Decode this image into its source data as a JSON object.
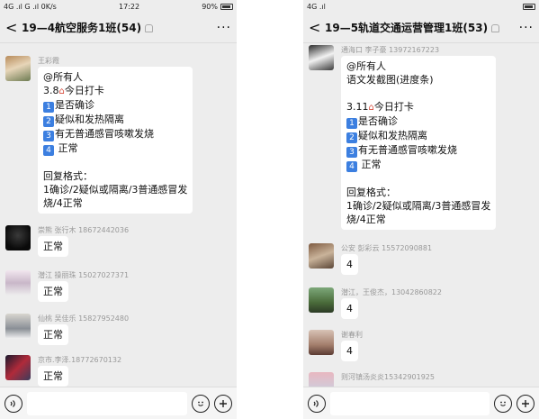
{
  "left": {
    "status": {
      "signal": "4G .ıl G .ıl 0K/s",
      "time": "17:22",
      "battery": "90%"
    },
    "nav": {
      "back": "<",
      "title": "19—4航空服务1班(54)",
      "more": "···"
    },
    "timestamp": "",
    "messages": [
      {
        "sender": "王彩霞",
        "lines": [
          "@所有人",
          "3.8{house}今日打卡",
          "{1}是否确诊",
          "{2}疑似和发热隔离",
          "{3}有无普通感冒咳嗽发烧",
          "{4} 正常",
          "",
          "回复格式：",
          "1确诊/2疑似或隔离/3普通感冒发",
          "烧/4正常"
        ]
      },
      {
        "sender": "崇熊      张行木 18672442036",
        "lines": [
          "正常"
        ]
      },
      {
        "sender": "潜江 操丽珠 15027027371",
        "lines": [
          "正常"
        ]
      },
      {
        "sender": "仙桃 吴佳乐 15827952480",
        "lines": [
          "正常"
        ]
      },
      {
        "sender": "京市.李泽.18772670132",
        "lines": [
          "正常"
        ]
      }
    ]
  },
  "right": {
    "status": {
      "signal": "4G .ıl",
      "time": "",
      "battery": ""
    },
    "nav": {
      "back": "<",
      "title": "19—5轨道交通运营管理1班(53)",
      "more": "···"
    },
    "messages": [
      {
        "sender": "通海口  李子豪 13972167223",
        "lines": [
          "@所有人",
          "语文发截图(进度条)",
          "",
          "3.11{house}今日打卡",
          "{1}是否确诊",
          "{2}疑似和发热隔离",
          "{3}有无普通感冒咳嗽发烧",
          "{4} 正常",
          "",
          "回复格式：",
          "1确诊/2疑似或隔离/3普通感冒发",
          "烧/4正常"
        ]
      },
      {
        "sender": "公安   彭彩云  15572090881",
        "lines": [
          "4"
        ]
      },
      {
        "sender": "潜江，王俊杰，13042860822",
        "lines": [
          "4"
        ]
      },
      {
        "sender": "谢春利",
        "lines": [
          "4"
        ]
      },
      {
        "sender": "则河镇汤炎炎15342901925",
        "lines": []
      }
    ]
  },
  "icons": {
    "back": "chevron-left-icon",
    "more": "more-icon",
    "mute": "mute-bell-icon",
    "voice": "voice-icon",
    "emoji": "emoji-icon",
    "plus": "plus-icon",
    "house": "house-icon"
  },
  "colors": {
    "badge": "#3c7fe0",
    "chat_bg": "#ededed",
    "bubble": "#ffffff"
  }
}
